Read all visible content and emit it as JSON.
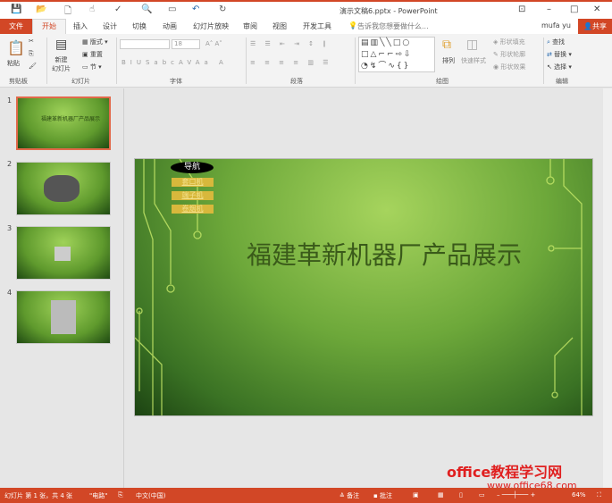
{
  "window": {
    "title": "演示文稿6.pptx - PowerPoint"
  },
  "tabs": [
    "文件",
    "开始",
    "插入",
    "设计",
    "切换",
    "动画",
    "幻灯片放映",
    "审阅",
    "视图",
    "开发工具"
  ],
  "tell_me": "告诉我您想要做什么...",
  "user": "mufa yu",
  "share": "共享",
  "ribbon": {
    "clipboard": {
      "label": "剪贴板",
      "paste": "粘贴"
    },
    "slides": {
      "label": "幻灯片",
      "new_slide": "新建\n幻灯片",
      "layout": "版式",
      "reset": "重置",
      "section": "节"
    },
    "font": {
      "label": "字体",
      "size": "18"
    },
    "paragraph": {
      "label": "段落"
    },
    "drawing": {
      "label": "绘图",
      "arrange": "排列",
      "quick_styles": "快速样式",
      "fill": "形状填充",
      "outline": "形状轮廓",
      "effects": "形状效果"
    },
    "editing": {
      "label": "编辑",
      "find": "查找",
      "replace": "替换",
      "select": "选择"
    }
  },
  "thumbnails": [
    {
      "num": "1",
      "title": "福建革新机器厂产品展示"
    },
    {
      "num": "2"
    },
    {
      "num": "3"
    },
    {
      "num": "4"
    }
  ],
  "slide": {
    "nav": "导航",
    "links": [
      "套口机",
      "端子机",
      "卷烟机"
    ],
    "title": "福建革新机器厂产品展示"
  },
  "status": {
    "slide_info": "幻灯片 第 1 张，共 4 张",
    "theme": "\"电路\"",
    "language": "中文(中国)",
    "notes": "备注",
    "comments": "批注",
    "zoom": "64%"
  },
  "watermark": {
    "line1": "office教程学习网",
    "line2": "www.office68.com"
  },
  "colors": {
    "accent": "#d24726"
  }
}
